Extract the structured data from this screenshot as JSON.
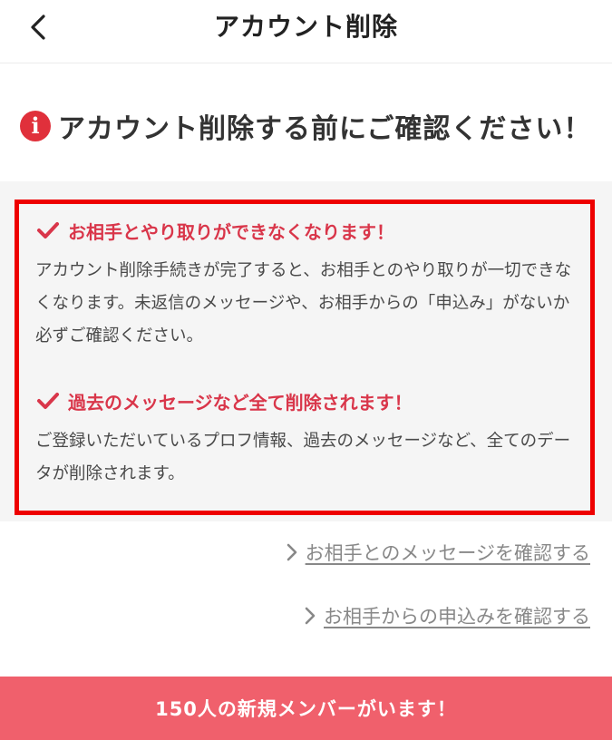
{
  "header": {
    "title": "アカウント削除",
    "back_icon": "chevron-left-icon"
  },
  "notice": {
    "icon": "info-icon",
    "icon_glyph": "i",
    "title": "アカウント削除する前にご確認ください！"
  },
  "warnings": [
    {
      "icon": "check-icon",
      "heading": "お相手とやり取りができなくなります！",
      "body": "アカウント削除手続きが完了すると、お相手とのやり取りが一切できなくなります。未返信のメッセージや、お相手からの「申込み」がないか必ずご確認ください。"
    },
    {
      "icon": "check-icon",
      "heading": "過去のメッセージなど全て削除されます！",
      "body": "ご登録いただいているプロフ情報、過去のメッセージなど、全てのデータが削除されます。"
    }
  ],
  "links": [
    {
      "label": "お相手とのメッセージを確認する",
      "icon": "chevron-right-icon"
    },
    {
      "label": "お相手からの申込みを確認する",
      "icon": "chevron-right-icon"
    }
  ],
  "bottom_bar": {
    "label": "150人の新規メンバーがいます！"
  },
  "colors": {
    "accent_red": "#d9364a",
    "border_red": "#ee0000",
    "bottom_bar": "#f0606c",
    "info_icon": "#e0303b"
  }
}
